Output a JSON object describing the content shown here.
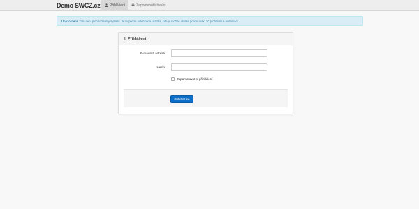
{
  "navbar": {
    "brand": "Demo SWCZ.cz",
    "items": [
      {
        "label": "Přihlášení",
        "icon": "user-icon",
        "active": true
      },
      {
        "label": "Zapomenuté heslo",
        "icon": "recover-icon",
        "active": false
      }
    ]
  },
  "alert": {
    "title": "Upozornění!",
    "text": "Toto není plnohodnotný systém. Je to pouze odlehčená ukázka, kde je možné ohlásit pouze max. 20 protokolů a reklamací."
  },
  "login": {
    "heading": "Přihlášení",
    "email_label": "E-mailová adresa",
    "email_value": "",
    "password_label": "Heslo",
    "password_value": "",
    "remember_label": "Zapamatovat si přihlášení",
    "remember_checked": false,
    "submit_label": "Přihlásit se"
  },
  "colors": {
    "accent": "#0d6fc7",
    "alert_bg": "#d9edf7",
    "alert_text": "#3a87ad"
  }
}
